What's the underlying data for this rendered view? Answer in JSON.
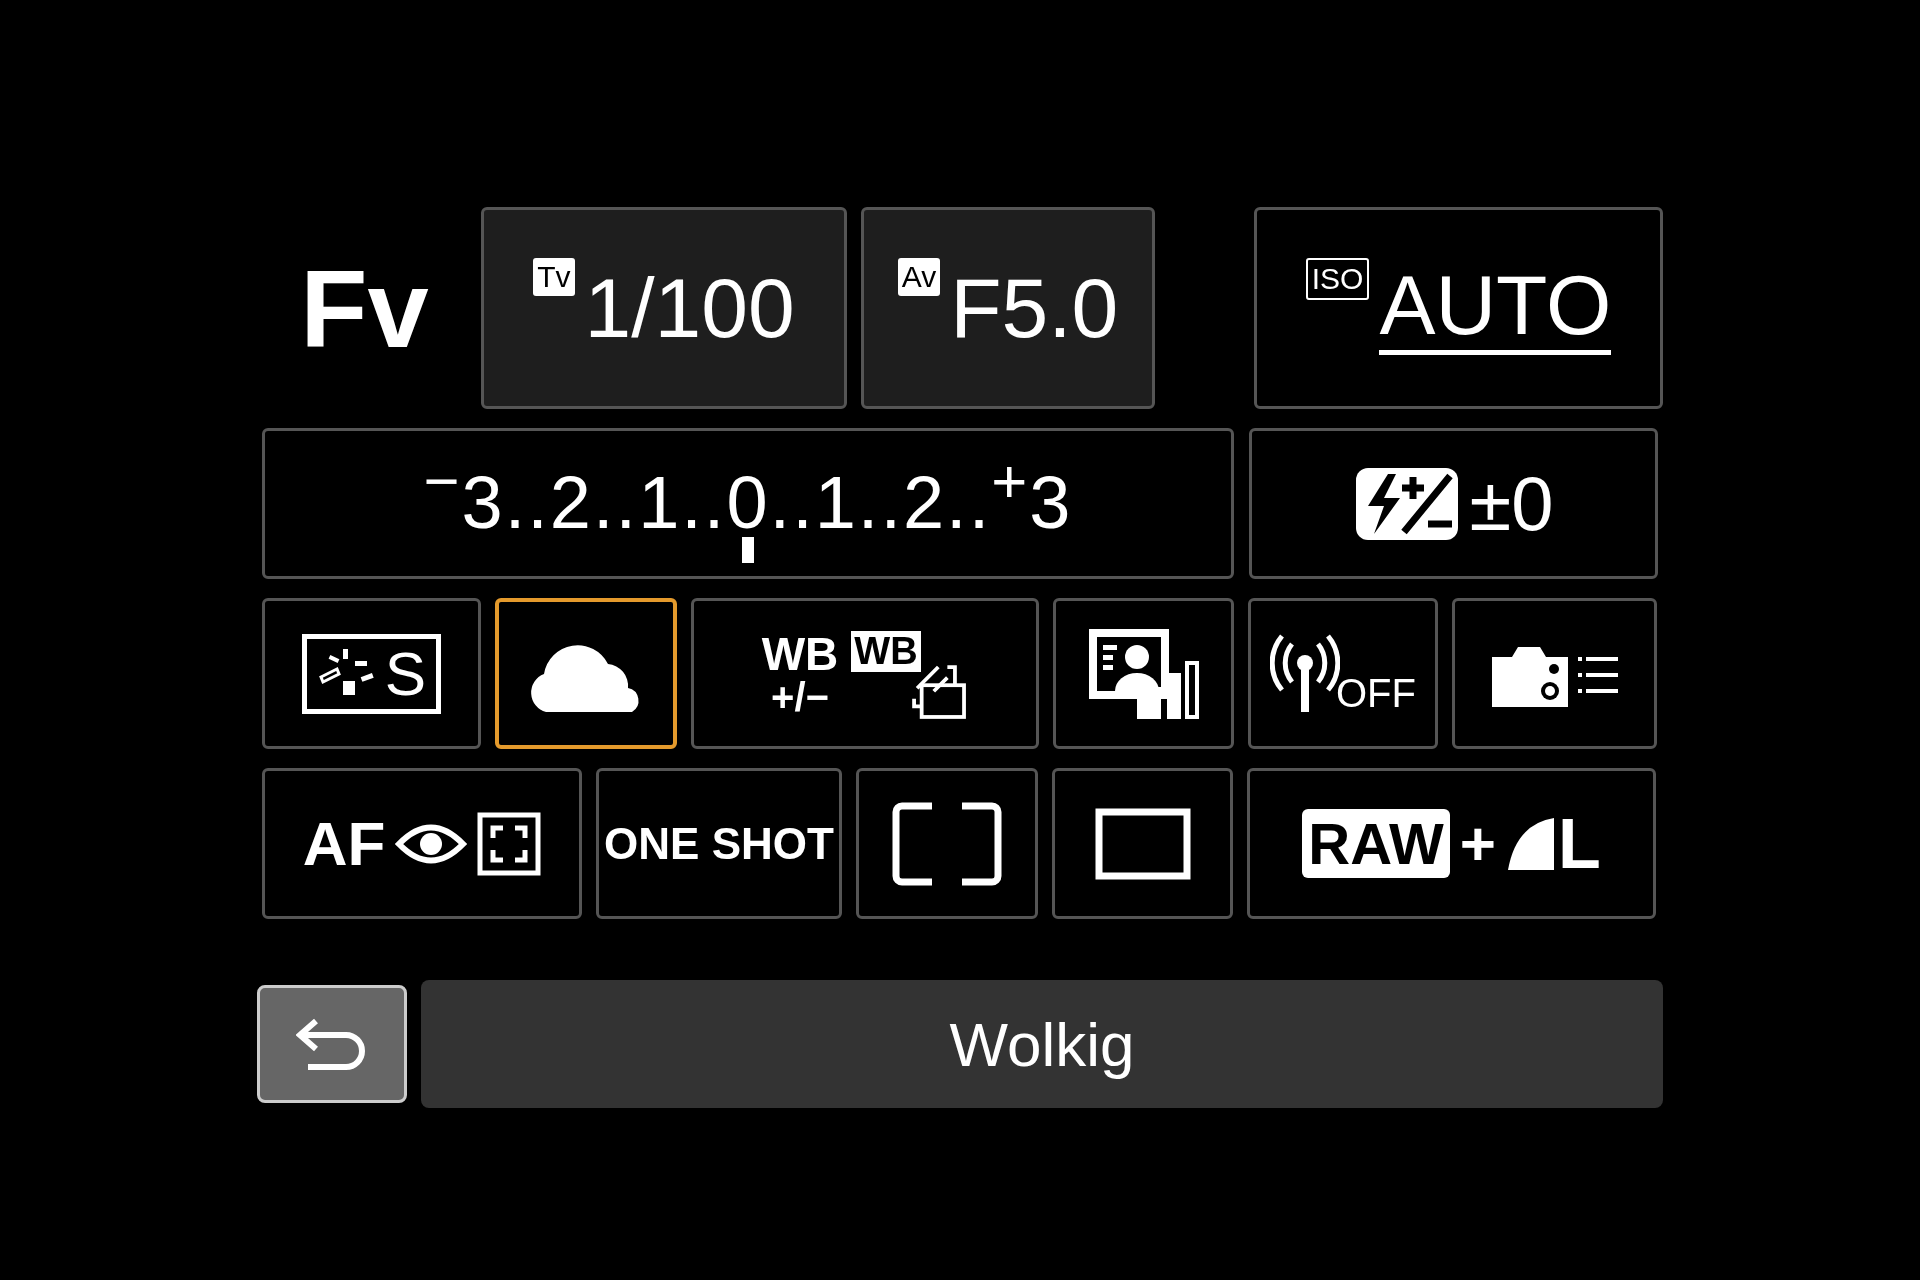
{
  "mode": "Fv",
  "exposure": [
    {
      "badge": "Tv",
      "value": "1/100"
    },
    {
      "badge": "Av",
      "value": "F5.0"
    }
  ],
  "iso": {
    "badge": "ISO",
    "value": "AUTO"
  },
  "meter": {
    "scale": "$^{−}$3..2..1..0..1..2..$^{+}$3",
    "level": 0.5
  },
  "flash_comp": {
    "value": "±0"
  },
  "row_settings": [
    {
      "kind": "picture_style",
      "label": "S",
      "selected": false
    },
    {
      "kind": "white_balance",
      "selected": true
    },
    {
      "kind": "wb_shift",
      "label": "WB",
      "sublabel": "+/−",
      "badge": "WB",
      "selected": false
    },
    {
      "kind": "display",
      "selected": false
    },
    {
      "kind": "wireless",
      "label": "OFF",
      "selected": false
    },
    {
      "kind": "camera_menu",
      "selected": false
    }
  ],
  "af_settings": [
    {
      "kind": "af_method",
      "label": "AF",
      "selected": false
    },
    {
      "kind": "af_operation",
      "label": "ONE SHOT",
      "selected": false
    },
    {
      "kind": "drive",
      "selected": false
    },
    {
      "kind": "metering",
      "selected": false
    },
    {
      "kind": "quality",
      "badge": "RAW",
      "label": "+",
      "size": "L",
      "selected": false
    }
  ],
  "footer": {
    "caption": "Wolkig"
  }
}
